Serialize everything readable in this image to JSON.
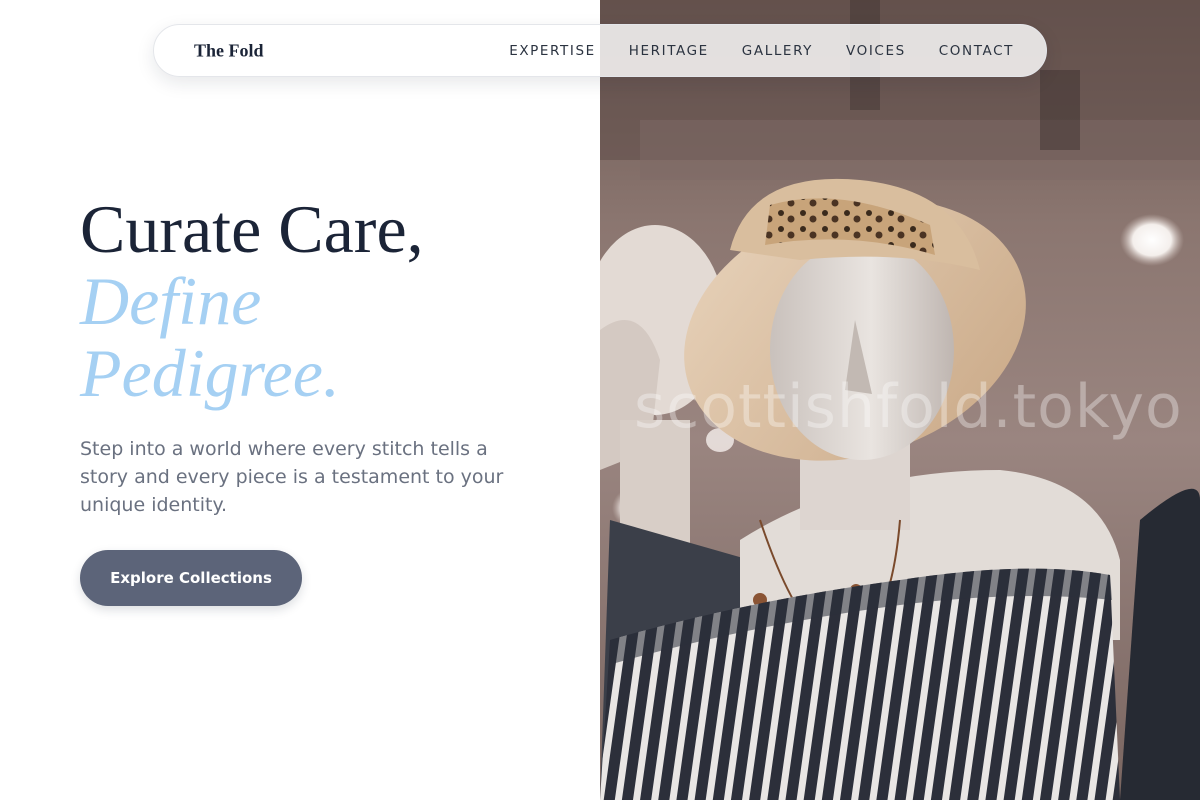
{
  "nav": {
    "brand": "The Fold",
    "links": [
      "EXPERTISE",
      "HERITAGE",
      "GALLERY",
      "VOICES",
      "CONTACT"
    ]
  },
  "hero": {
    "headline_line1": "Curate Care,",
    "headline_line2": "Define",
    "headline_line3": "Pedigree.",
    "subtext": "Step into a world where every stitch tells a story and every piece is a testament to your unique identity.",
    "cta_label": "Explore Collections",
    "photo_watermark": "scottishfold.tokyo"
  },
  "colors": {
    "headline_dark": "#1b2437",
    "headline_accent": "#a5d0f3",
    "body_text": "#6a7180",
    "button_bg": "#5c6479",
    "button_text": "#ffffff"
  }
}
